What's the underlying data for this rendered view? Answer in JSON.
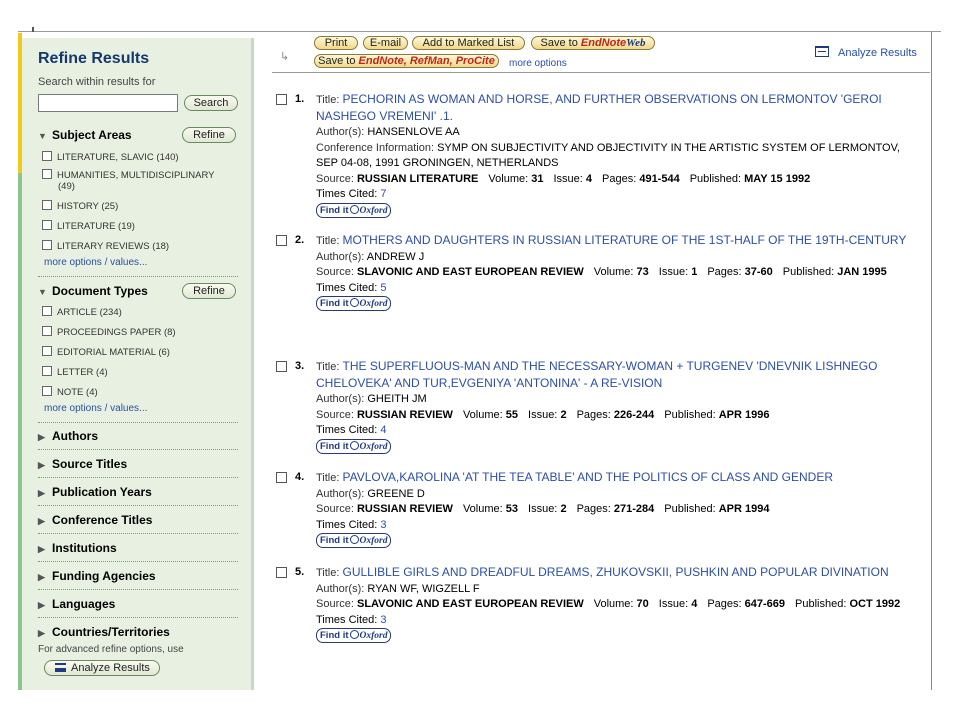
{
  "sidebar": {
    "title": "Refine Results",
    "search_label": "Search within results for",
    "search_button": "Search",
    "refine_button": "Refine",
    "subject_areas": {
      "heading": "Subject Areas",
      "items": [
        "LITERATURE, SLAVIC (140)",
        "HUMANITIES, MULTIDISCIPLINARY",
        "(49)",
        "HISTORY (25)",
        "LITERATURE (19)",
        "LITERARY REVIEWS (18)"
      ],
      "more": "more options / values..."
    },
    "document_types": {
      "heading": "Document Types",
      "items": [
        "ARTICLE (234)",
        "PROCEEDINGS PAPER (8)",
        "EDITORIAL MATERIAL (6)",
        "LETTER (4)",
        "NOTE (4)"
      ],
      "more": "more options / values..."
    },
    "collapsed_sections": [
      "Authors",
      "Source Titles",
      "Publication Years",
      "Conference Titles",
      "Institutions",
      "Funding Agencies",
      "Languages",
      "Countries/Territories"
    ],
    "advanced_note": "For advanced refine options, use",
    "analyze_button": "Analyze Results"
  },
  "toolbar": {
    "print": "Print",
    "email": "E-mail",
    "marked_list": "Add to Marked List",
    "save_to_web": "Save to",
    "endnote_web_brand": "EndNote",
    "endnote_web_suffix": "Web",
    "save_to_desktop": "Save to",
    "desktop_brands": "EndNote, RefMan, ProCite",
    "more_options": "more options",
    "analyze_results": "Analyze Results"
  },
  "labels": {
    "title": "Title:",
    "authors": "Author(s):",
    "conference": "Conference Information:",
    "source": "Source:",
    "volume": "Volume:",
    "issue": "Issue:",
    "pages": "Pages:",
    "published": "Published:",
    "times_cited": "Times Cited:",
    "find_it": "Find it",
    "oxford": "Oxford"
  },
  "records": [
    {
      "num": "1.",
      "title": "PECHORIN AS WOMAN AND HORSE, AND FURTHER OBSERVATIONS ON LERMONTOV 'GEROI NASHEGO VREMENI' .1.",
      "authors": "HANSENLOVE AA",
      "conference": "SYMP ON SUBJECTIVITY AND OBJECTIVITY IN THE ARTISTIC SYSTEM OF LERMONTOV, SEP 04-08, 1991 GRONINGEN, NETHERLANDS",
      "source": "RUSSIAN LITERATURE",
      "volume": "31",
      "issue": "4",
      "pages": "491-544",
      "published": "MAY 15 1992",
      "times_cited": "7"
    },
    {
      "num": "2.",
      "title": "MOTHERS AND DAUGHTERS IN RUSSIAN LITERATURE OF THE 1ST-HALF OF THE 19TH-CENTURY",
      "authors": "ANDREW J",
      "source": "SLAVONIC AND EAST EUROPEAN REVIEW",
      "volume": "73",
      "issue": "1",
      "pages": "37-60",
      "published": "JAN 1995",
      "times_cited": "5"
    },
    {
      "num": "3.",
      "title": "THE SUPERFLUOUS-MAN AND THE NECESSARY-WOMAN + TURGENEV 'DNEVNIK LISHNEGO CHELOVEKA' AND TUR,EVGENIYA 'ANTONINA' - A RE-VISION",
      "authors": "GHEITH JM",
      "source": "RUSSIAN REVIEW",
      "volume": "55",
      "issue": "2",
      "pages": "226-244",
      "published": "APR 1996",
      "times_cited": "4"
    },
    {
      "num": "4.",
      "title": "PAVLOVA,KAROLINA 'AT THE TEA TABLE' AND THE POLITICS OF CLASS AND GENDER",
      "authors": "GREENE D",
      "source": "RUSSIAN REVIEW",
      "volume": "53",
      "issue": "2",
      "pages": "271-284",
      "published": "APR 1994",
      "times_cited": "3"
    },
    {
      "num": "5.",
      "title": "GULLIBLE GIRLS AND DREADFUL DREAMS, ZHUKOVSKII, PUSHKIN AND POPULAR DIVINATION",
      "authors": "RYAN WF, WIGZELL F",
      "source": "SLAVONIC AND EAST EUROPEAN REVIEW",
      "volume": "70",
      "issue": "4",
      "pages": "647-669",
      "published": "OCT 1992",
      "times_cited": "3"
    }
  ],
  "colors": {
    "sidebar_bg": "#e8f1e1",
    "link": "#2a4ea8",
    "heading": "#14386e",
    "accent_yellow": "#f2c81a"
  }
}
